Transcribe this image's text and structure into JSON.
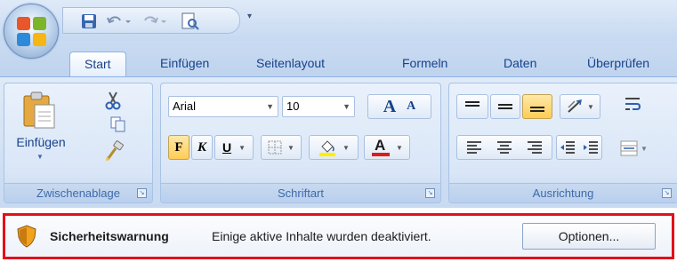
{
  "qat": {
    "icons": [
      "save-icon",
      "undo-icon",
      "redo-icon",
      "print-preview-icon"
    ],
    "customize_glyph": "▾"
  },
  "tabs": [
    "Start",
    "Einfügen",
    "Seitenlayout",
    "Formeln",
    "Daten",
    "Überprüfen"
  ],
  "active_tab": "Start",
  "groups": {
    "clipboard": {
      "label": "Zwischenablage",
      "paste_label": "Einfügen"
    },
    "font": {
      "label": "Schriftart",
      "font_name": "Arial",
      "font_size": "10",
      "grow_glyph": "A",
      "shrink_glyph": "A",
      "bold_glyph": "F",
      "italic_glyph": "K",
      "underline_glyph": "U",
      "color_glyph": "A"
    },
    "alignment": {
      "label": "Ausrichtung"
    }
  },
  "security_bar": {
    "title": "Sicherheitswarnung",
    "message": "Einige aktive Inhalte wurden deaktiviert.",
    "options_label": "Optionen..."
  },
  "colors": {
    "accent_highlight": "#ffcc55",
    "warning_border": "#e3101a",
    "font_color": "#e01b1b",
    "fill_color": "#ffee00"
  }
}
